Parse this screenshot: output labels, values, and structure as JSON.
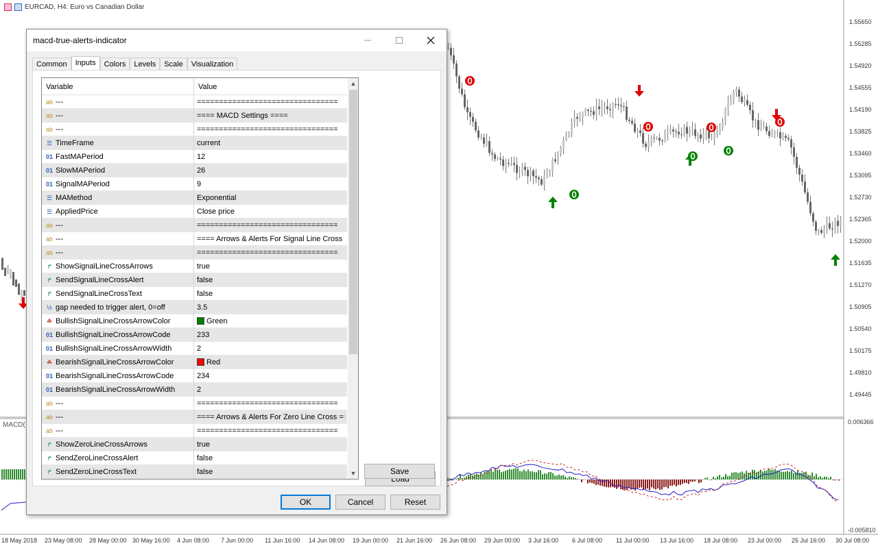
{
  "chart": {
    "title": "EURCAD, H4:  Euro vs Canadian Dollar",
    "indicator_label": "MACD(",
    "price_labels": [
      "1.55650",
      "1.55285",
      "1.54920",
      "1.54555",
      "1.54190",
      "1.53825",
      "1.53460",
      "1.53095",
      "1.52730",
      "1.52365",
      "1.52000",
      "1.51635",
      "1.51270",
      "1.50905",
      "1.50540",
      "1.50175",
      "1.49810",
      "1.49445"
    ],
    "macd_labels": [
      "0.006366",
      "-0.005810"
    ],
    "time_labels": [
      "18 May 2018",
      "23 May 08:00",
      "28 May 00:00",
      "30 May 16:00",
      "4 Jun 08:00",
      "7 Jun 00:00",
      "11 Jun 16:00",
      "14 Jun 08:00",
      "19 Jun 00:00",
      "21 Jun 16:00",
      "26 Jun 08:00",
      "29 Jun 00:00",
      "3 Jul 16:00",
      "6 Jul 08:00",
      "11 Jul 00:00",
      "13 Jul 16:00",
      "18 Jul 08:00",
      "23 Jul 00:00",
      "25 Jul 16:00",
      "30 Jul 08:00"
    ]
  },
  "dialog": {
    "title": "macd-true-alerts-indicator",
    "tabs": [
      "Common",
      "Inputs",
      "Colors",
      "Levels",
      "Scale",
      "Visualization"
    ],
    "active_tab": "Inputs",
    "columns": {
      "variable": "Variable",
      "value": "Value"
    },
    "rows": [
      {
        "icon": "ab",
        "variable": "---",
        "value": "================================"
      },
      {
        "icon": "ab",
        "variable": "---",
        "value": "==== MACD Settings ===="
      },
      {
        "icon": "ab",
        "variable": "---",
        "value": "================================"
      },
      {
        "icon": "enum",
        "variable": "TimeFrame",
        "value": "current"
      },
      {
        "icon": "01",
        "variable": "FastMAPeriod",
        "value": "12"
      },
      {
        "icon": "01",
        "variable": "SlowMAPeriod",
        "value": "26"
      },
      {
        "icon": "01",
        "variable": "SignalMAPeriod",
        "value": "9"
      },
      {
        "icon": "enum",
        "variable": "MAMethod",
        "value": "Exponential"
      },
      {
        "icon": "enum",
        "variable": "AppliedPrice",
        "value": "Close price"
      },
      {
        "icon": "ab",
        "variable": "---",
        "value": "================================"
      },
      {
        "icon": "ab",
        "variable": "---",
        "value": "==== Arrows & Alerts For Signal Line Cross ===="
      },
      {
        "icon": "ab",
        "variable": "---",
        "value": "================================"
      },
      {
        "icon": "bool",
        "variable": "ShowSignalLineCrossArrows",
        "value": "true"
      },
      {
        "icon": "bool",
        "variable": "SendSignalLineCrossAlert",
        "value": "false"
      },
      {
        "icon": "bool",
        "variable": "SendSignalLineCrossText",
        "value": "false"
      },
      {
        "icon": "half",
        "variable": "gap needed to trigger alert, 0=off",
        "value": "3.5"
      },
      {
        "icon": "color",
        "variable": "BullishSignalLineCrossArrowColor",
        "value": "Green",
        "swatch": "#008000"
      },
      {
        "icon": "01",
        "variable": "BullishSignalLineCrossArrowCode",
        "value": "233"
      },
      {
        "icon": "01",
        "variable": "BullishSignalLineCrossArrowWidth",
        "value": "2"
      },
      {
        "icon": "color",
        "variable": "BearishSignalLineCrossArrowColor",
        "value": "Red",
        "swatch": "#ff0000"
      },
      {
        "icon": "01",
        "variable": "BearishSignalLineCrossArrowCode",
        "value": "234"
      },
      {
        "icon": "01",
        "variable": "BearishSignalLineCrossArrowWidth",
        "value": "2"
      },
      {
        "icon": "ab",
        "variable": "---",
        "value": "================================"
      },
      {
        "icon": "ab",
        "variable": "---",
        "value": "==== Arrows & Alerts For Zero Line Cross ===="
      },
      {
        "icon": "ab",
        "variable": "---",
        "value": "================================"
      },
      {
        "icon": "bool",
        "variable": "ShowZeroLineCrossArrows",
        "value": "true"
      },
      {
        "icon": "bool",
        "variable": "SendZeroLineCrossAlert",
        "value": "false"
      },
      {
        "icon": "bool",
        "variable": "SendZeroLineCrossText",
        "value": "false"
      }
    ],
    "buttons": {
      "load": "Load",
      "save": "Save",
      "ok": "OK",
      "cancel": "Cancel",
      "reset": "Reset"
    }
  }
}
